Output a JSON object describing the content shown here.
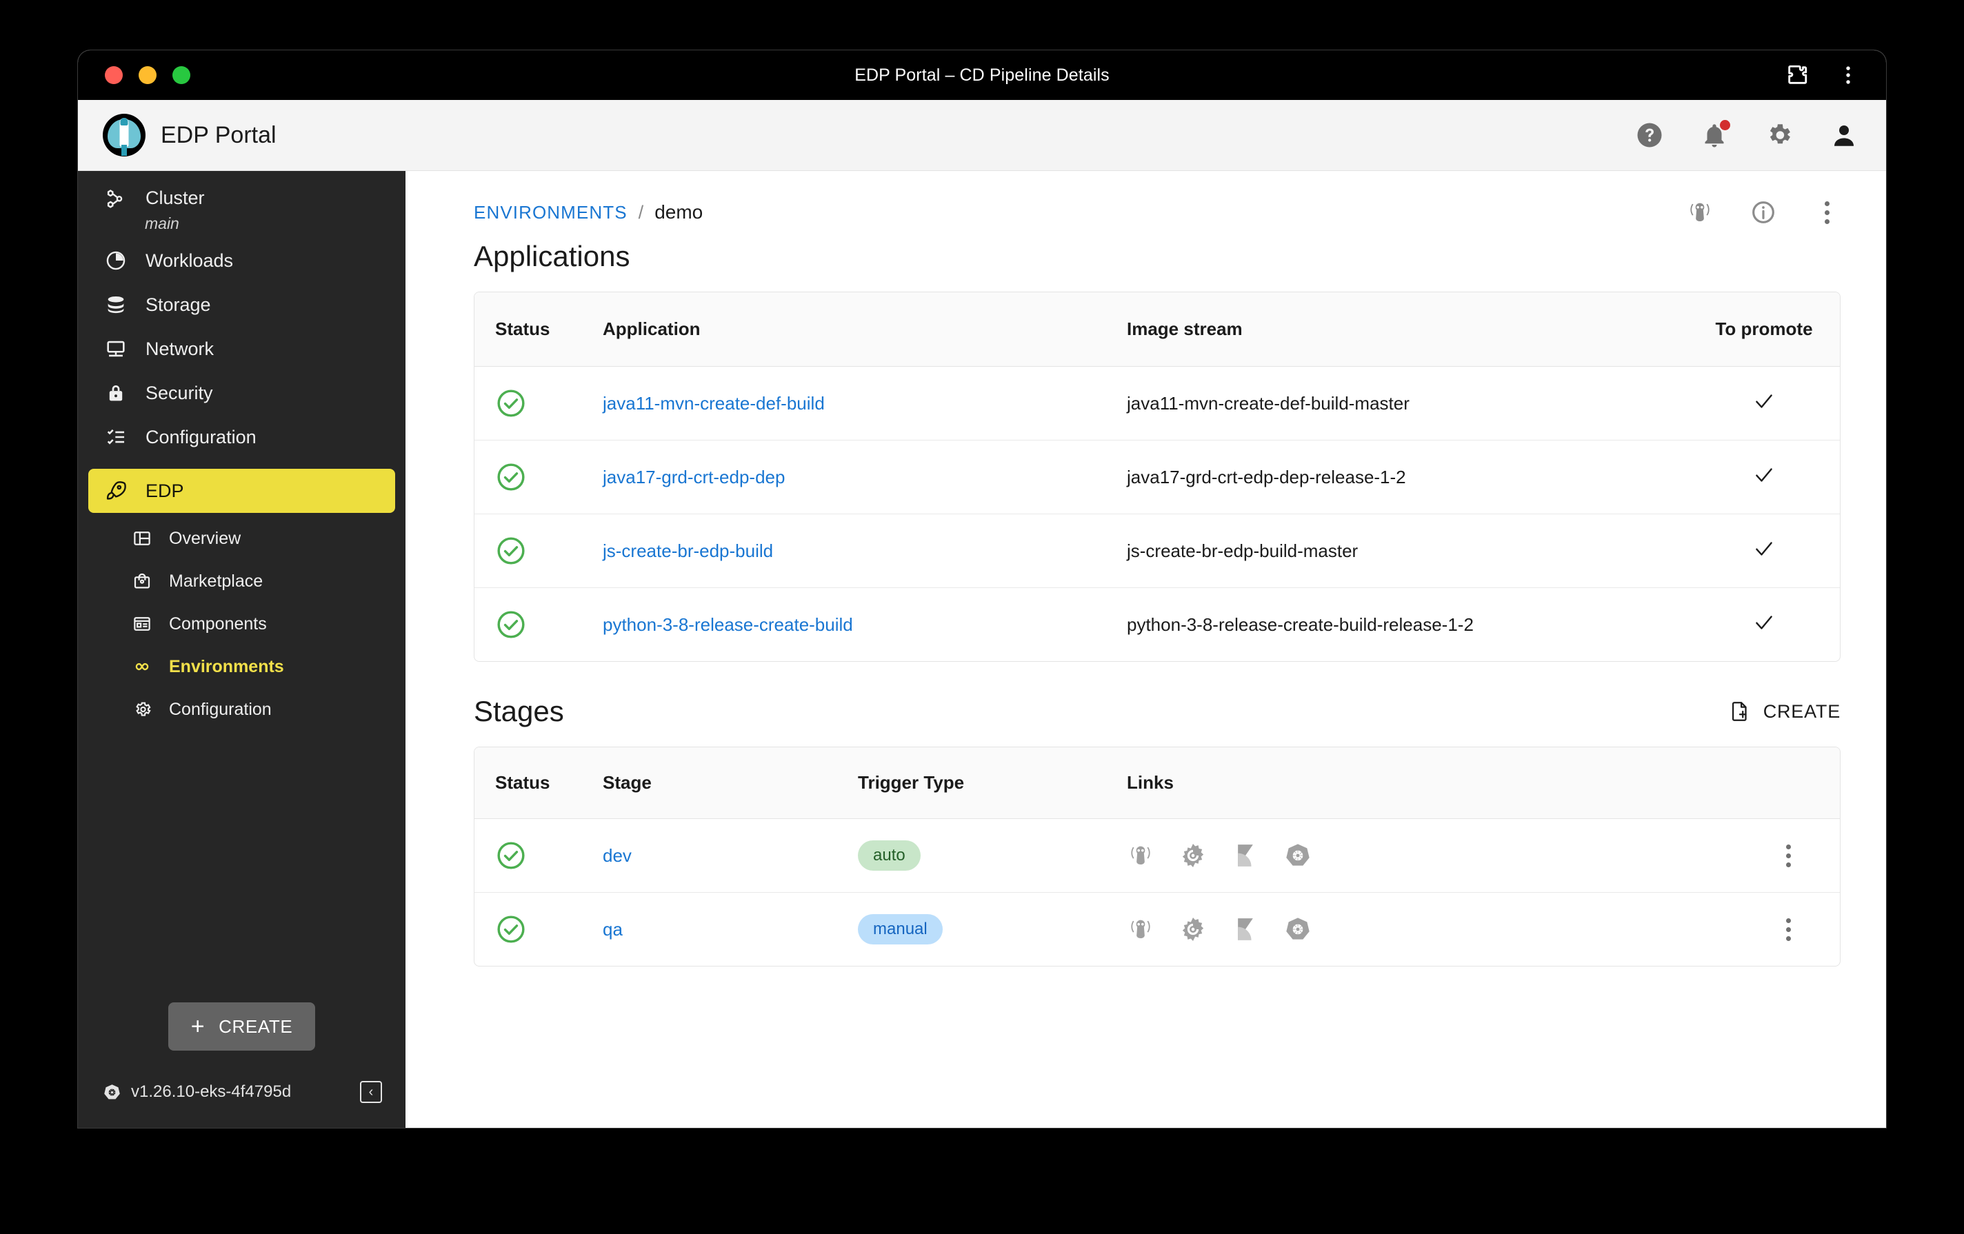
{
  "window": {
    "title": "EDP Portal – CD Pipeline Details",
    "traffic_lights": [
      "close",
      "minimize",
      "maximize"
    ],
    "right_icons": [
      "puzzle-extension-icon",
      "browser-menu-icon"
    ]
  },
  "app_header": {
    "brand_title": "EDP Portal",
    "logo_icon": "rocket-logo",
    "actions": [
      {
        "name": "help-icon",
        "label": "?"
      },
      {
        "name": "notifications-icon",
        "has_badge": true
      },
      {
        "name": "settings-gear-icon",
        "has_badge": false
      },
      {
        "name": "user-account-icon",
        "has_badge": false
      }
    ]
  },
  "sidebar": {
    "items": [
      {
        "label": "Cluster",
        "sublabel": "main",
        "icon": "cluster-icon"
      },
      {
        "label": "Workloads",
        "icon": "workloads-icon"
      },
      {
        "label": "Storage",
        "icon": "storage-icon"
      },
      {
        "label": "Network",
        "icon": "network-icon"
      },
      {
        "label": "Security",
        "icon": "security-lock-icon"
      },
      {
        "label": "Configuration",
        "icon": "configuration-icon"
      }
    ],
    "edp": {
      "label": "EDP",
      "icon": "rocket-icon",
      "highlight_color": "#edde3e"
    },
    "sub_items": [
      {
        "label": "Overview",
        "icon": "overview-icon",
        "active": false
      },
      {
        "label": "Marketplace",
        "icon": "marketplace-icon",
        "active": false
      },
      {
        "label": "Components",
        "icon": "components-icon",
        "active": false
      },
      {
        "label": "Environments",
        "icon": "environments-infinity-icon",
        "active": true
      },
      {
        "label": "Configuration",
        "icon": "gear-icon",
        "active": false
      }
    ],
    "create_label": "CREATE",
    "version": "v1.26.10-eks-4f4795d",
    "version_icon": "kubernetes-icon",
    "collapse_icon": "collapse-left-icon"
  },
  "breadcrumb": {
    "root": "ENVIRONMENTS",
    "separator": "/",
    "current": "demo",
    "actions": [
      "argocd-icon",
      "info-icon",
      "kebab-menu-icon"
    ]
  },
  "applications": {
    "title": "Applications",
    "columns": [
      "Status",
      "Application",
      "Image stream",
      "To promote"
    ],
    "rows": [
      {
        "status": "ok",
        "application": "java11-mvn-create-def-build",
        "image_stream": "java11-mvn-create-def-build-master",
        "to_promote": true
      },
      {
        "status": "ok",
        "application": "java17-grd-crt-edp-dep",
        "image_stream": "java17-grd-crt-edp-dep-release-1-2",
        "to_promote": true
      },
      {
        "status": "ok",
        "application": "js-create-br-edp-build",
        "image_stream": "js-create-br-edp-build-master",
        "to_promote": true
      },
      {
        "status": "ok",
        "application": "python-3-8-release-create-build",
        "image_stream": "python-3-8-release-create-build-release-1-2",
        "to_promote": true
      }
    ]
  },
  "stages": {
    "title": "Stages",
    "create_label": "CREATE",
    "create_icon": "file-plus-icon",
    "columns": [
      "Status",
      "Stage",
      "Trigger Type",
      "Links",
      ""
    ],
    "rows": [
      {
        "status": "ok",
        "stage": "dev",
        "trigger_type": "auto",
        "trigger_style": "auto",
        "links": [
          "argocd-icon",
          "grafana-icon",
          "kibana-icon",
          "kubernetes-icon"
        ]
      },
      {
        "status": "ok",
        "stage": "qa",
        "trigger_type": "manual",
        "trigger_style": "manual",
        "links": [
          "argocd-icon",
          "grafana-icon",
          "kibana-icon",
          "kubernetes-icon"
        ]
      }
    ]
  },
  "colors": {
    "accent_yellow": "#edde3e",
    "link_blue": "#1976d2",
    "status_green": "#4caf50",
    "chip_auto_bg": "#c8e6c9",
    "chip_manual_bg": "#bbdefb",
    "sidebar_bg": "#262626"
  }
}
